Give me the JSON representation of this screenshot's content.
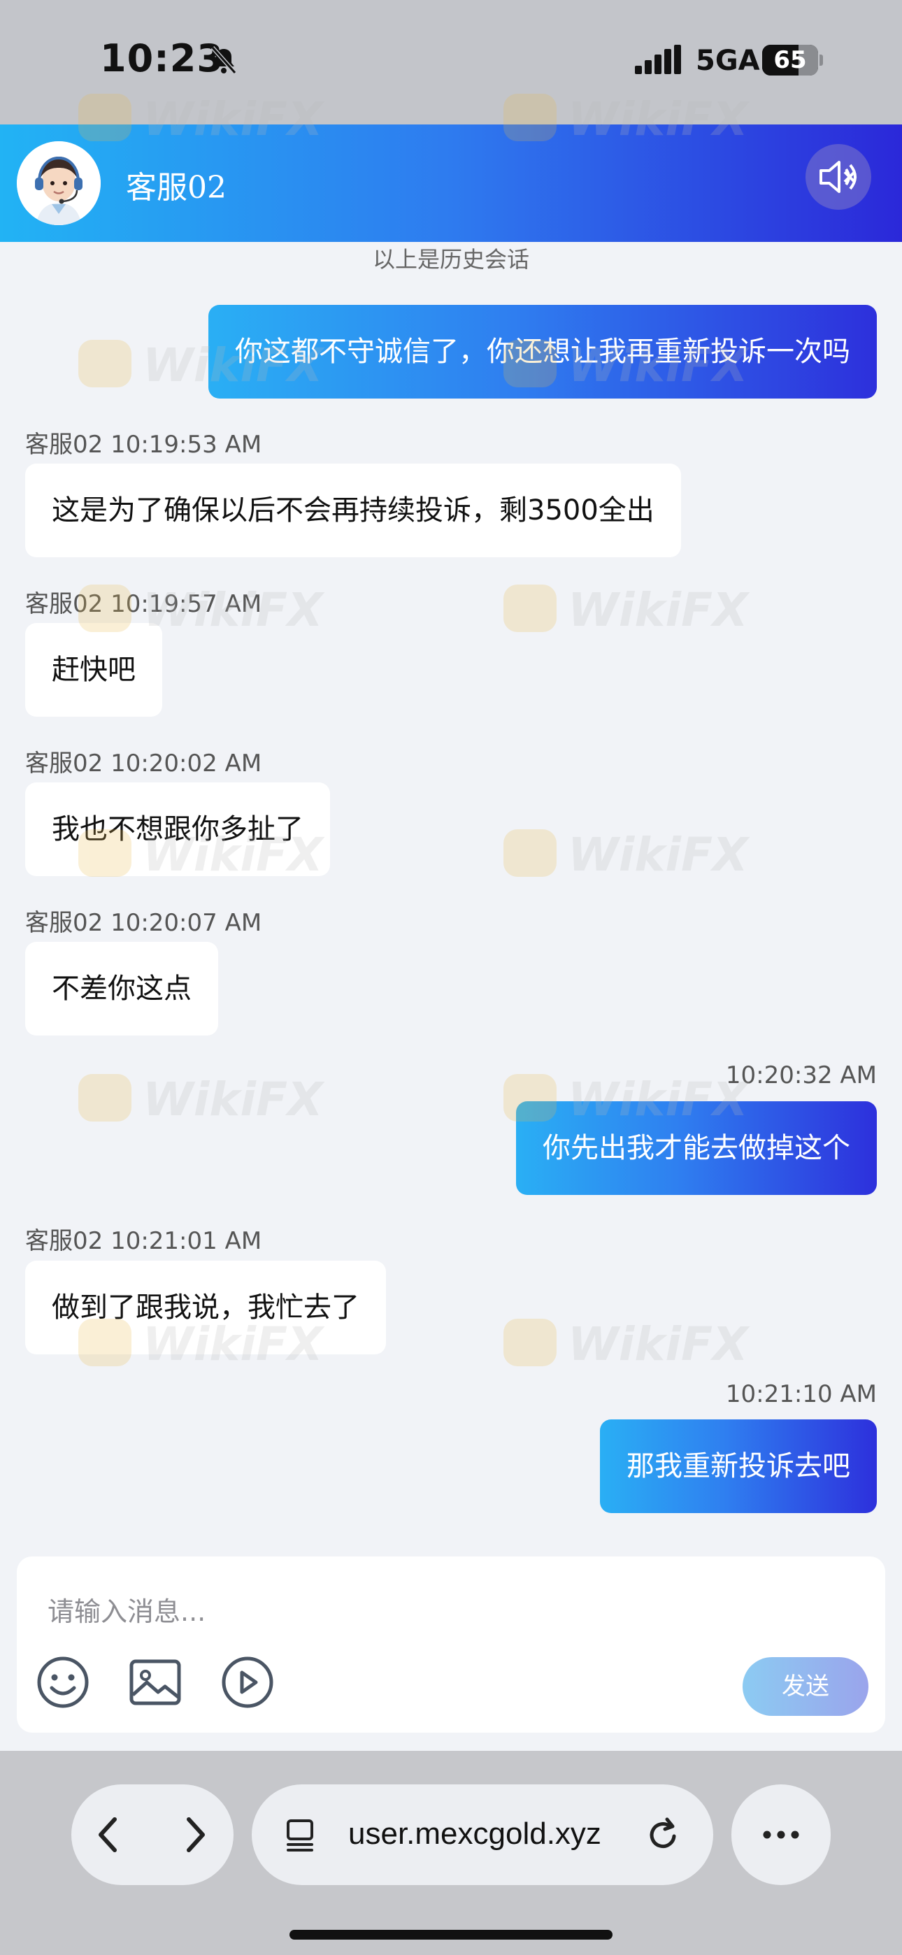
{
  "status_bar": {
    "time": "10:23",
    "network": "5GA",
    "battery_percent": 65,
    "battery_label": "65"
  },
  "header": {
    "agent_name": "客服02"
  },
  "chat": {
    "history_note": "以上是历史会话",
    "messages": [
      {
        "direction": "out",
        "meta": "",
        "text": "你这都不守诚信了，你还想让我再重新投诉一次吗"
      },
      {
        "direction": "in",
        "meta": "客服02 10:19:53 AM",
        "text": "这是为了确保以后不会再持续投诉，剩3500全出"
      },
      {
        "direction": "in",
        "meta": "客服02 10:19:57 AM",
        "text": "赶快吧"
      },
      {
        "direction": "in",
        "meta": "客服02 10:20:02 AM",
        "text": "我也不想跟你多扯了"
      },
      {
        "direction": "in",
        "meta": "客服02 10:20:07 AM",
        "text": "不差你这点"
      },
      {
        "direction": "out",
        "meta": "10:20:32 AM",
        "text": "你先出我才能去做掉这个"
      },
      {
        "direction": "in",
        "meta": "客服02 10:21:01 AM",
        "text": "做到了跟我说，我忙去了"
      },
      {
        "direction": "out",
        "meta": "10:21:10 AM",
        "text": "那我重新投诉去吧"
      }
    ]
  },
  "composer": {
    "placeholder": "请输入消息...",
    "send_label": "发送"
  },
  "browser": {
    "url": "user.mexcgold.xyz"
  },
  "watermark": {
    "text": "WikiFX",
    "logo_color": "#e9b949"
  },
  "colors": {
    "gradient_start": "#22b3f4",
    "gradient_end": "#2b28d9",
    "incoming_bubble": "#ffffff",
    "chat_background": "#f1f3f7"
  },
  "icons": {
    "status": [
      "bell-muted-icon",
      "signal-icon",
      "battery-icon"
    ],
    "header": [
      "headset-agent-avatar",
      "speaker-muted-icon"
    ],
    "composer": [
      "emoji-icon",
      "image-icon",
      "video-play-icon"
    ],
    "browser": [
      "back-icon",
      "forward-icon",
      "tabs-icon",
      "reload-icon",
      "more-icon"
    ]
  }
}
